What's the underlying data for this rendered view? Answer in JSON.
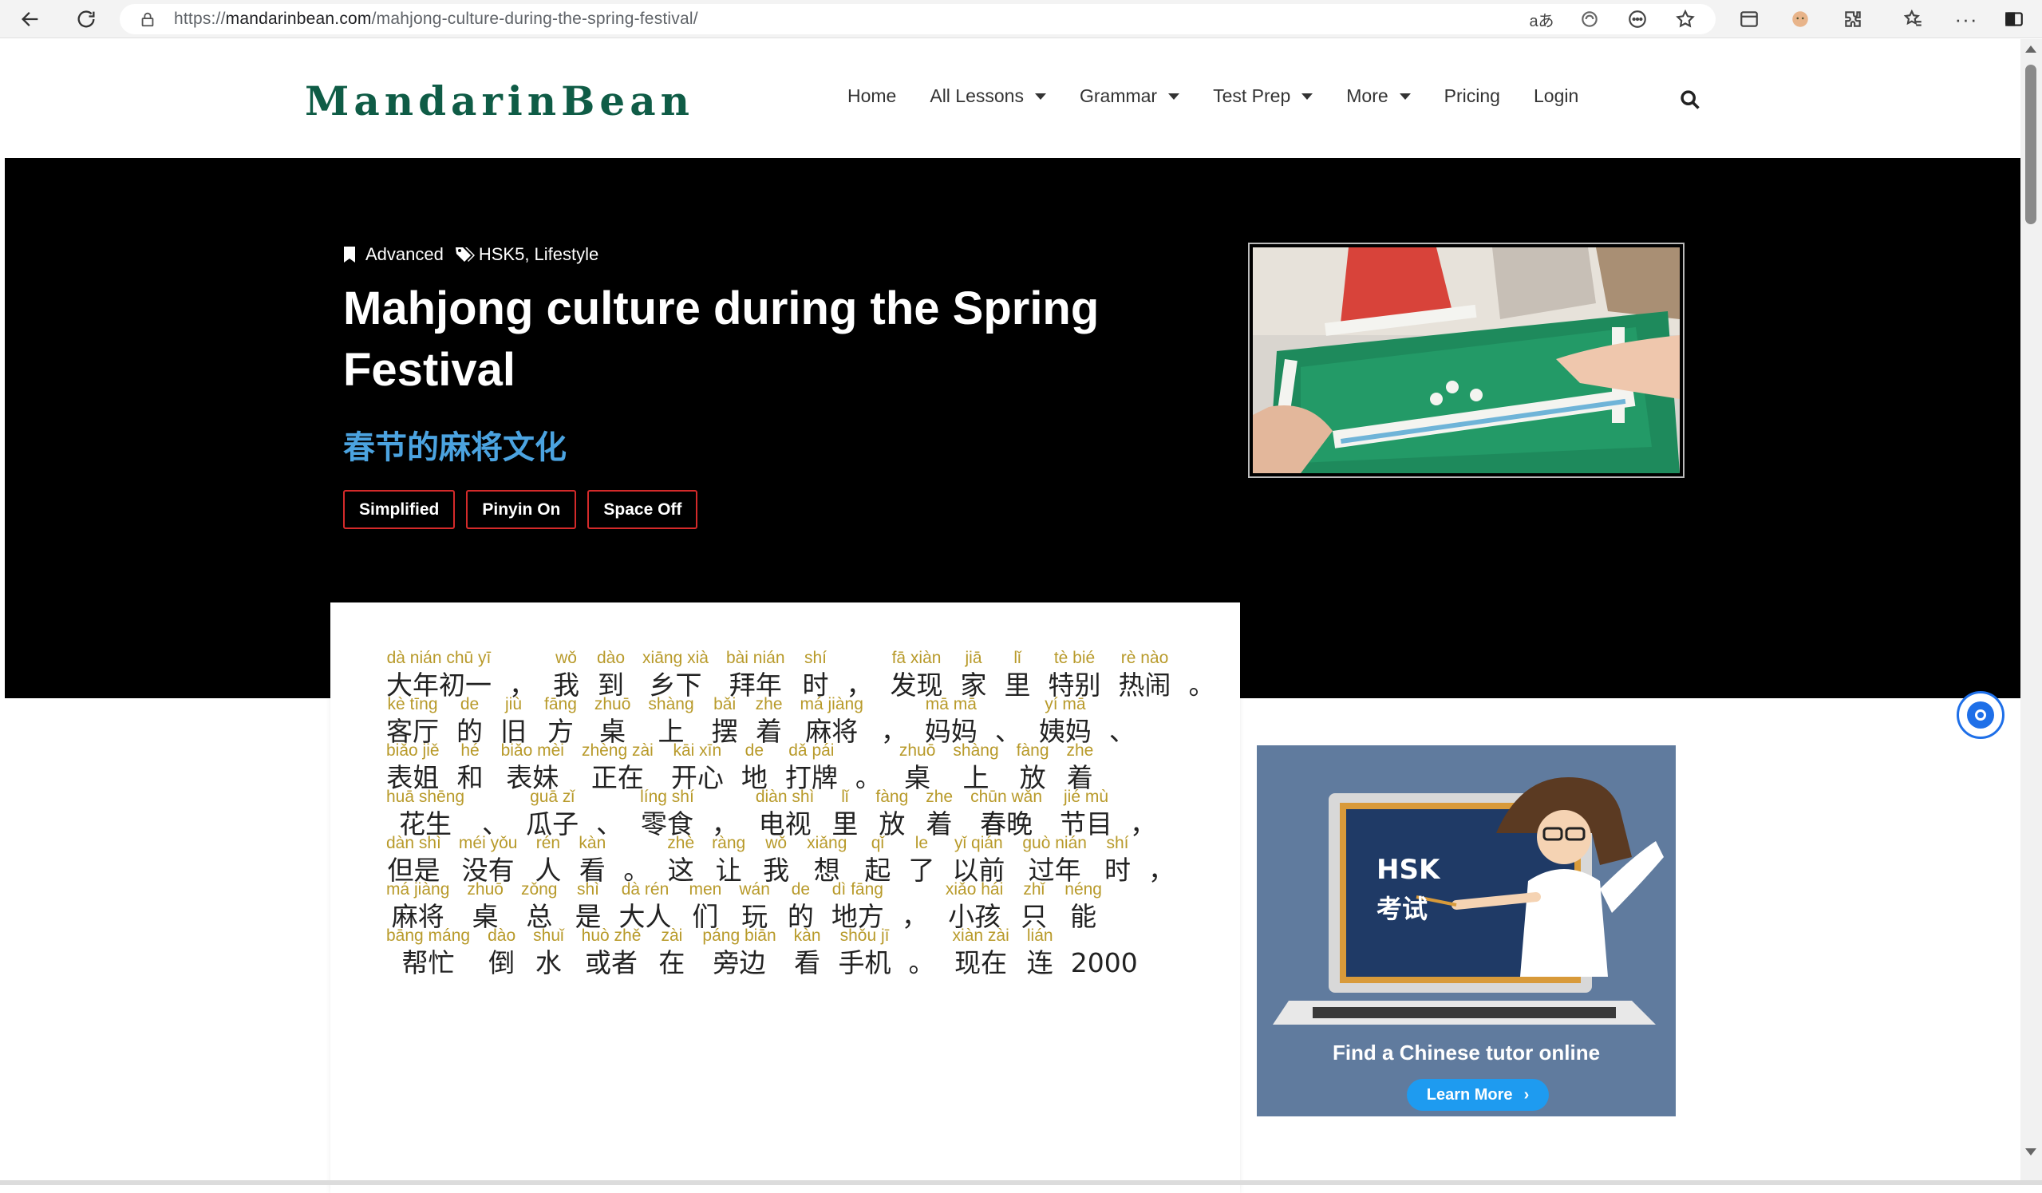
{
  "browser": {
    "url_prefix": "https://",
    "url_host": "mandarinbean.com",
    "url_path": "/mahjong-culture-during-the-spring-festival/",
    "icons": [
      "back-icon",
      "reload-icon",
      "lock-icon",
      "read-aloud-icon",
      "translate-icon",
      "emoji-icon",
      "favorite-star-icon",
      "sidebar-icon",
      "profile-icon",
      "extensions-icon",
      "favorites-icon",
      "more-icon",
      "split-screen-icon"
    ]
  },
  "header": {
    "logo_text": "MandarinBean",
    "nav": [
      {
        "label": "Home",
        "dropdown": false
      },
      {
        "label": "All Lessons",
        "dropdown": true
      },
      {
        "label": "Grammar",
        "dropdown": true
      },
      {
        "label": "Test Prep",
        "dropdown": true
      },
      {
        "label": "More",
        "dropdown": true
      },
      {
        "label": "Pricing",
        "dropdown": false
      },
      {
        "label": "Login",
        "dropdown": false
      }
    ]
  },
  "hero": {
    "level": "Advanced",
    "tags": "HSK5, Lifestyle",
    "title": "Mahjong culture during the Spring Festival",
    "subtitle": "春节的麻将文化",
    "toggles": [
      "Simplified",
      "Pinyin On",
      "Space Off"
    ]
  },
  "lesson": {
    "lines": [
      [
        [
          "dà nián chū yī",
          "大年初一"
        ],
        [
          "",
          "，"
        ],
        [
          "wǒ",
          "我"
        ],
        [
          "dào",
          "到"
        ],
        [
          "xiāng xià",
          "乡下"
        ],
        [
          "bài nián",
          "拜年"
        ],
        [
          "shí",
          "时"
        ],
        [
          "",
          "，"
        ],
        [
          "fā xiàn",
          "发现"
        ],
        [
          "jiā",
          "家"
        ],
        [
          "lǐ",
          "里"
        ],
        [
          "tè bié",
          "特别"
        ],
        [
          "rè nào",
          "热闹"
        ],
        [
          "",
          "。"
        ]
      ],
      [
        [
          "kè tīng",
          "客厅"
        ],
        [
          "de",
          "的"
        ],
        [
          "jiù",
          "旧"
        ],
        [
          "fāng",
          "方"
        ],
        [
          "zhuō",
          "桌"
        ],
        [
          "shàng",
          "上"
        ],
        [
          "bǎi",
          "摆"
        ],
        [
          "zhe",
          "着"
        ],
        [
          "má jiàng",
          "麻将"
        ],
        [
          "",
          "，"
        ],
        [
          "mā mā",
          "妈妈"
        ],
        [
          "",
          "、"
        ],
        [
          "yí mā",
          "姨妈"
        ],
        [
          "",
          "、"
        ]
      ],
      [
        [
          "biǎo jiě",
          "表姐"
        ],
        [
          "hé",
          "和"
        ],
        [
          "biǎo mèi",
          "表妹"
        ],
        [
          "zhèng zài",
          "正在"
        ],
        [
          "kāi xīn",
          "开心"
        ],
        [
          "de",
          "地"
        ],
        [
          "dǎ pái",
          "打牌"
        ],
        [
          "",
          "。"
        ],
        [
          "zhuō",
          "桌"
        ],
        [
          "shàng",
          "上"
        ],
        [
          "fàng",
          "放"
        ],
        [
          "zhe",
          "着"
        ]
      ],
      [
        [
          "huā shēng",
          "花生"
        ],
        [
          "",
          "、"
        ],
        [
          "guā zǐ",
          "瓜子"
        ],
        [
          "",
          "、"
        ],
        [
          "líng shí",
          "零食"
        ],
        [
          "",
          "，"
        ],
        [
          "diàn shì",
          "电视"
        ],
        [
          "lǐ",
          "里"
        ],
        [
          "fàng",
          "放"
        ],
        [
          "zhe",
          "着"
        ],
        [
          "chūn wǎn",
          "春晚"
        ],
        [
          "jié mù",
          "节目"
        ],
        [
          "",
          "，"
        ]
      ],
      [
        [
          "dàn shì",
          "但是"
        ],
        [
          "méi yǒu",
          "没有"
        ],
        [
          "rén",
          "人"
        ],
        [
          "kàn",
          "看"
        ],
        [
          "",
          "。"
        ],
        [
          "zhè",
          "这"
        ],
        [
          "ràng",
          "让"
        ],
        [
          "wǒ",
          "我"
        ],
        [
          "xiǎng",
          "想"
        ],
        [
          "qǐ",
          "起"
        ],
        [
          "le",
          "了"
        ],
        [
          "yǐ qián",
          "以前"
        ],
        [
          "guò nián",
          "过年"
        ],
        [
          "shí",
          "时"
        ],
        [
          "",
          "，"
        ]
      ],
      [
        [
          "má jiàng",
          "麻将"
        ],
        [
          "zhuō",
          "桌"
        ],
        [
          "zǒng",
          "总"
        ],
        [
          "shì",
          "是"
        ],
        [
          "dà rén",
          "大人"
        ],
        [
          "men",
          "们"
        ],
        [
          "wán",
          "玩"
        ],
        [
          "de",
          "的"
        ],
        [
          "dì fāng",
          "地方"
        ],
        [
          "",
          "，"
        ],
        [
          "xiǎo hái",
          "小孩"
        ],
        [
          "zhǐ",
          "只"
        ],
        [
          "néng",
          "能"
        ]
      ],
      [
        [
          "bāng máng",
          "帮忙"
        ],
        [
          "dào",
          "倒"
        ],
        [
          "shuǐ",
          "水"
        ],
        [
          "huò zhě",
          "或者"
        ],
        [
          "zài",
          "在"
        ],
        [
          "páng biān",
          "旁边"
        ],
        [
          "kàn",
          "看"
        ],
        [
          "shǒu jī",
          "手机"
        ],
        [
          "",
          "。"
        ],
        [
          "xiàn zài",
          "现在"
        ],
        [
          "lián",
          "连"
        ],
        [
          "",
          "2000"
        ]
      ]
    ]
  },
  "ad": {
    "screen_line1": "HSK",
    "screen_line2": "考试",
    "caption": "Find a Chinese tutor online",
    "cta": "Learn More"
  },
  "colors": {
    "brand_green": "#0f5c46",
    "hero_bg": "#000000",
    "subtitle_blue": "#4ba3e0",
    "toggle_border": "#d42a2a",
    "pinyin_gold": "#b89a2a",
    "ad_bg": "#607b9e",
    "cta_blue": "#1e9bf0"
  }
}
